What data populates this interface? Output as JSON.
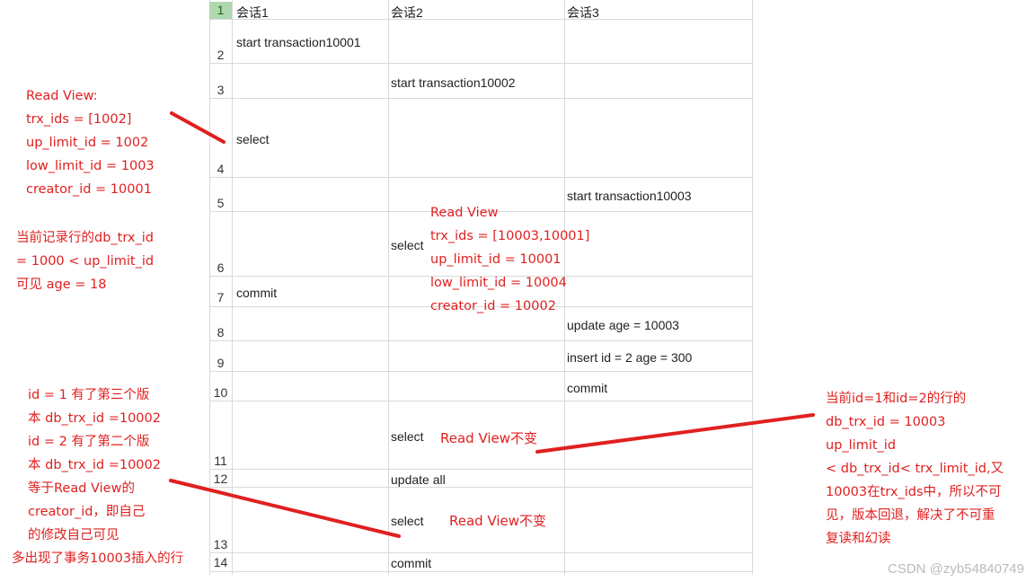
{
  "columns": [
    "会话1",
    "会话2",
    "会话3"
  ],
  "rows": [
    "1",
    "2",
    "3",
    "4",
    "5",
    "6",
    "7",
    "8",
    "9",
    "10",
    "11",
    "12",
    "13",
    "14"
  ],
  "cells": {
    "r2c1": "start transaction10001",
    "r3c2": "start transaction10002",
    "r4c1": "select",
    "r5c3": "start transaction10003",
    "r6c2": "select",
    "r7c1": "commit",
    "r8c3": "update age = 10003",
    "r9c3": "insert id = 2 age = 300",
    "r10c3": "commit",
    "r11c2": "select",
    "r12c2": "update all",
    "r13c2": "select",
    "r14c2": "commit"
  },
  "notes": {
    "left_top": [
      "Read View:",
      "trx_ids = [1002]",
      "up_limit_id = 1002",
      "low_limit_id = 1003",
      "creator_id = 10001"
    ],
    "left_mid": [
      "当前记录行的db_trx_id",
      "= 1000 < up_limit_id",
      "可见 age = 18"
    ],
    "center": [
      "Read View",
      "trx_ids = [10003,10001]",
      "up_limit_id = 10001",
      "low_limit_id = 10004",
      "creator_id = 10002"
    ],
    "left_bottom": [
      "id = 1 有了第三个版",
      "本 db_trx_id =10002",
      "id = 2 有了第二个版",
      "本 db_trx_id =10002",
      "等于Read View的",
      "creator_id，即自己",
      "的修改自己可见",
      "多出现了事务10003插入的行"
    ],
    "right": [
      "当前id=1和id=2的行的",
      "db_trx_id = 10003",
      "up_limit_id",
      "< db_trx_id< trx_limit_id,又",
      "10003在trx_ids中，所以不可",
      "见，版本回退，解决了不可重",
      "复读和幻读"
    ],
    "row11_inline": "Read View不变",
    "row13_inline": "Read View不变"
  },
  "watermark": "CSDN @zyb54840749",
  "colors": {
    "annotation": "#e02020",
    "gridline": "#d9d9d9",
    "selected_row_header": "#aed8ae"
  }
}
